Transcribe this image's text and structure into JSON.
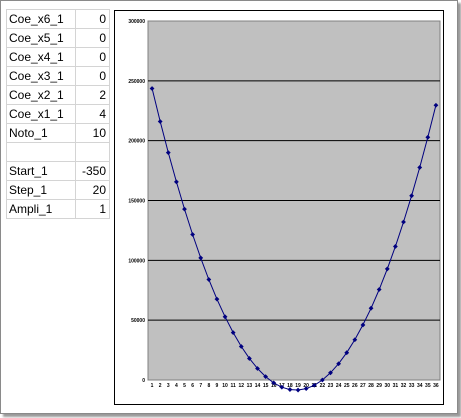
{
  "params": [
    {
      "name": "Coe_x6_1",
      "value": "0"
    },
    {
      "name": "Coe_x5_1",
      "value": "0"
    },
    {
      "name": "Coe_x4_1",
      "value": "0"
    },
    {
      "name": "Coe_x3_1",
      "value": "0"
    },
    {
      "name": "Coe_x2_1",
      "value": "2"
    },
    {
      "name": "Coe_x1_1",
      "value": "4"
    },
    {
      "name": "Noto_1",
      "value": "10"
    },
    {
      "name": "",
      "value": ""
    },
    {
      "name": "Start_1",
      "value": "-350"
    },
    {
      "name": "Step_1",
      "value": "20"
    },
    {
      "name": "Ampli_1",
      "value": "1"
    }
  ],
  "chart_data": {
    "type": "line",
    "title": "",
    "xlabel": "",
    "ylabel": "",
    "ylim": [
      0,
      300000
    ],
    "y_ticks": [
      "0",
      "50000",
      "100000",
      "150000",
      "200000",
      "250000",
      "300000"
    ],
    "categories": [
      "1",
      "2",
      "3",
      "4",
      "5",
      "6",
      "7",
      "8",
      "9",
      "10",
      "11",
      "12",
      "13",
      "14",
      "15",
      "16",
      "17",
      "18",
      "19",
      "20",
      "21",
      "22",
      "23",
      "24",
      "25",
      "26",
      "27",
      "28",
      "29",
      "30",
      "31",
      "32",
      "33",
      "34",
      "35",
      "36"
    ],
    "series": [
      {
        "name": "",
        "values": [
          243610,
          216010,
          190010,
          165610,
          142810,
          121610,
          102010,
          84010,
          67610,
          52810,
          39610,
          28010,
          18010,
          9610,
          2810,
          -2390,
          -5990,
          -7990,
          -8390,
          -7190,
          -4390,
          10,
          6010,
          13610,
          22810,
          33610,
          46010,
          60010,
          75610,
          92810,
          111610,
          132010,
          154010,
          177610,
          202810,
          229610
        ]
      }
    ],
    "grid": true,
    "legend": "none",
    "colors": {
      "plot_bg": "#c0c0c0",
      "line": "#00007f",
      "grid": "#000000"
    }
  }
}
